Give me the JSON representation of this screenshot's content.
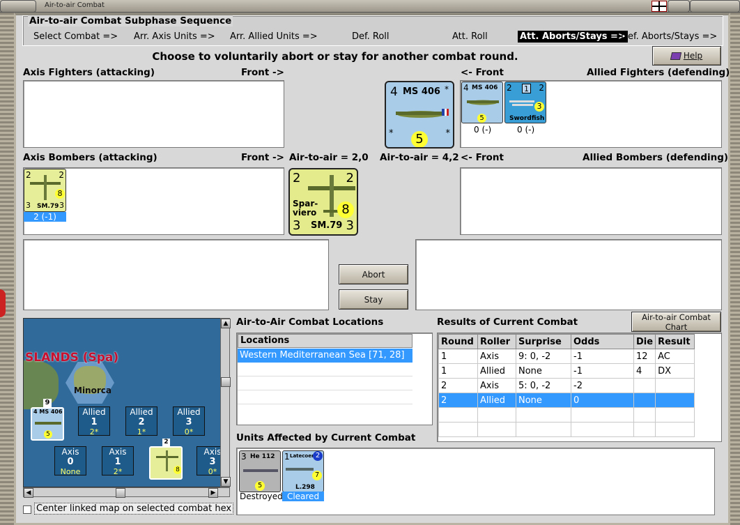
{
  "window": {
    "title": "Air-to-air Combat"
  },
  "sequence": {
    "title": "Air-to-air Combat Subphase Sequence",
    "steps": [
      "Select Combat =>",
      "Arr. Axis Units =>",
      "Arr. Allied Units =>",
      "Def. Roll",
      "Att. Roll",
      "Att. Aborts/Stays =>",
      "Def. Aborts/Stays =>"
    ],
    "active_index": 5
  },
  "instruction": "Choose to voluntarily abort or stay for another combat round.",
  "help_label": "Help",
  "sections": {
    "axis_fighters": "Axis Fighters (attacking)",
    "front_right": "Front ->",
    "front_left": "<- Front",
    "allied_fighters": "Allied Fighters (defending)",
    "axis_bombers": "Axis Bombers (attacking)",
    "allied_bombers": "Allied Bombers (defending)",
    "axis_ata": "Air-to-air = 2,0",
    "allied_ata": "Air-to-air = 4,2"
  },
  "units": {
    "ms406_big": {
      "name": "MS 406",
      "attack": "4",
      "value": "5"
    },
    "ms406_small": {
      "name": "MS 406",
      "attack": "4",
      "value": "5",
      "status": "0 (-)"
    },
    "swordfish": {
      "name": "Swordfish",
      "left": "2",
      "center": "1",
      "right": "2",
      "value": "3",
      "status": "0 (-)"
    },
    "sm79_small": {
      "name": "SM.79",
      "label": "Spar-\nviero",
      "tl": "2",
      "tr": "2",
      "bl": "3",
      "br": "3",
      "value": "8",
      "status": "2 (-1)"
    },
    "sm79_big": {
      "name": "SM.79",
      "label1": "Spar-",
      "label2": "viero",
      "tl": "2",
      "tr": "2",
      "bl": "3",
      "br": "3",
      "value": "8"
    }
  },
  "buttons": {
    "abort": "Abort",
    "stay": "Stay",
    "chart": "Air-to-air Combat Chart"
  },
  "map": {
    "region_label": "SLANDS (Spa)",
    "island": "Minorca",
    "stack_count": "9",
    "stack2_count": "2",
    "zones_allied": [
      {
        "side": "Allied",
        "num": "1",
        "sub": "2*"
      },
      {
        "side": "Allied",
        "num": "2",
        "sub": "1*"
      },
      {
        "side": "Allied",
        "num": "3",
        "sub": "0*"
      }
    ],
    "zones_axis": [
      {
        "side": "Axis",
        "num": "0",
        "sub": "None"
      },
      {
        "side": "Axis",
        "num": "1",
        "sub": "2*"
      },
      {
        "side": "Axis",
        "num": "3",
        "sub": "0*"
      }
    ],
    "center_checkbox": "Center linked map on selected combat hex"
  },
  "locations": {
    "title": "Air-to-Air Combat Locations",
    "header": "Locations",
    "rows": [
      "Western Mediterranean Sea [71, 28]"
    ]
  },
  "results": {
    "title": "Results of Current Combat",
    "headers": [
      "Round",
      "Roller",
      "Surprise",
      "Odds",
      "Die",
      "Result"
    ],
    "rows": [
      [
        "1",
        "Axis",
        "9: 0, -2",
        "-1",
        "12",
        "AC"
      ],
      [
        "1",
        "Allied",
        "None",
        "-1",
        "4",
        "DX"
      ],
      [
        "2",
        "Axis",
        "5: 0, -2",
        "-2",
        "",
        ""
      ],
      [
        "2",
        "Allied",
        "None",
        "0",
        "",
        ""
      ]
    ],
    "selected_row": 3
  },
  "affected": {
    "title": "Units Affected by Current Combat",
    "units": [
      {
        "name": "He 112",
        "attack": "3",
        "value": "5",
        "status": "Destroyed"
      },
      {
        "name": "Latecoere",
        "sub": "L.298",
        "attack": "1",
        "value": "7",
        "badge": "2",
        "status": "Cleared"
      }
    ]
  },
  "colors": {
    "selection": "#3399ff",
    "active_step": "#000000",
    "allied_counter": "#a9cde9",
    "axis_counter": "#e7ee9a"
  }
}
